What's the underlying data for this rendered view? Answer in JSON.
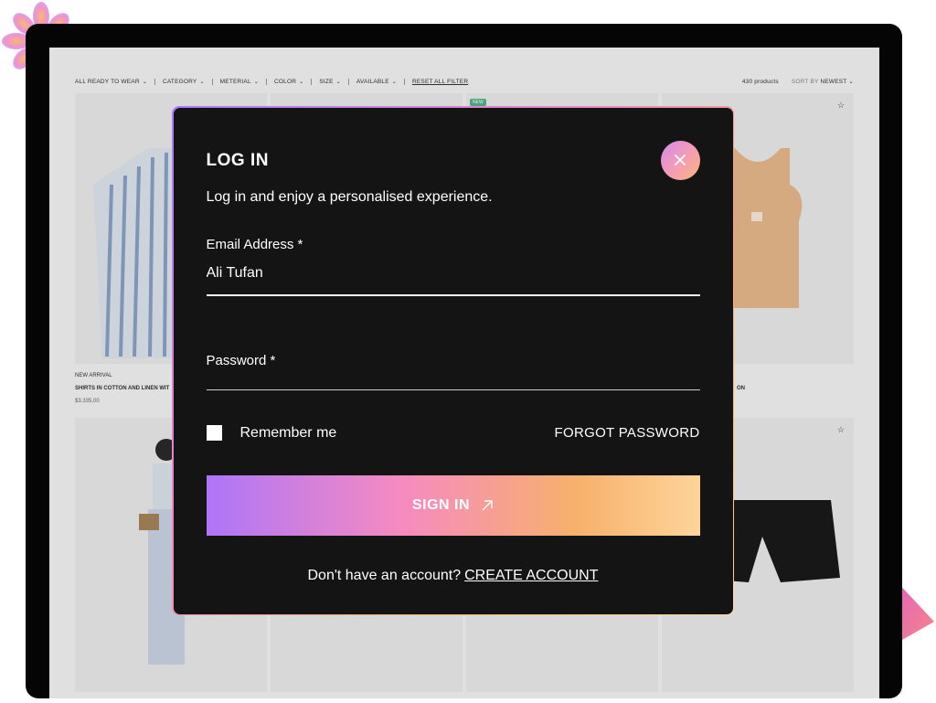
{
  "filters": {
    "items": [
      "ALL READY TO WEAR",
      "CATEGORY",
      "METERIAL",
      "COLOR",
      "SIZE",
      "AVAILABLE"
    ],
    "reset": "RESET ALL FILTER",
    "count": "430 products",
    "sort_label": "SORT BY",
    "sort_value": "NEWEST"
  },
  "products": {
    "p1_tag": "NEW ARRIVAL",
    "p1_name": "SHIRTS IN COTTON AND LINEN WIT",
    "p1_price": "$3.335,00",
    "p2_badge": "NEW",
    "p4_name_tail": "ON"
  },
  "modal": {
    "title": "LOG IN",
    "subtitle": "Log in and enjoy a personalised experience.",
    "email_label": "Email Address *",
    "email_value": "Ali Tufan",
    "password_label": "Password *",
    "remember_label": "Remember me",
    "forgot_label": "FORGOT PASSWORD",
    "signin_label": "SIGN IN",
    "footer_text": "Don't have an account?",
    "create_label": "CREATE ACCOUNT"
  },
  "icons": {
    "close": "close-icon",
    "arrow": "arrow-up-right-icon",
    "chevron": "chevron-down-icon",
    "star": "star-icon"
  },
  "colors": {
    "modal_bg": "#141414",
    "gradient_start": "#ae75f8",
    "gradient_mid": "#f68bbf",
    "gradient_end": "#fed49a",
    "frame": "#050505"
  }
}
